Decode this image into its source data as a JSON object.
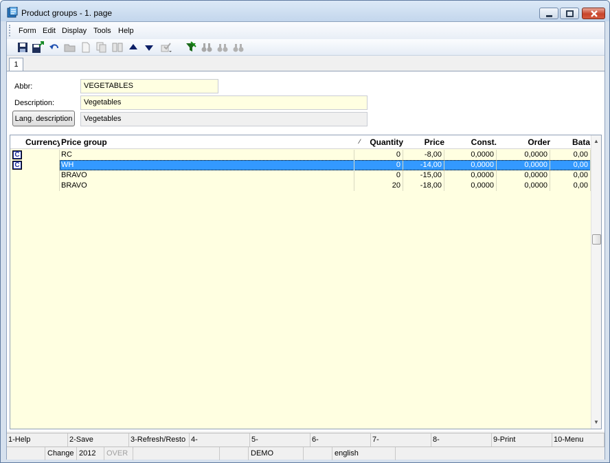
{
  "window": {
    "title": "Product groups - 1. page"
  },
  "menu": [
    "Form",
    "Edit",
    "Display",
    "Tools",
    "Help"
  ],
  "toolbar_icons": [
    "save-icon",
    "save-close-icon",
    "undo-icon",
    "open-folder-icon",
    "new-document-icon",
    "copy-icon",
    "book-icon",
    "arrow-up-icon",
    "arrow-down-icon",
    "check-icon",
    "filter-icon",
    "binoculars-icon",
    "find-next-icon",
    "find-prev-icon"
  ],
  "tab": {
    "label": "1"
  },
  "form": {
    "abbr_label": "Abbr:",
    "abbr_value": "VEGETABLES",
    "description_label": "Description:",
    "description_value": "Vegetables",
    "lang_button": "Lang. description",
    "lang_value": "Vegetables"
  },
  "grid": {
    "columns": [
      "Currency",
      "Price group",
      "Quantity",
      "Price",
      "Const.",
      "Order",
      "Bata"
    ],
    "rows": [
      {
        "currency_icon": "C",
        "price_group": "RC",
        "quantity": "0",
        "price": "-8,00",
        "const": "0,0000",
        "order": "0,0000",
        "bata": "0,00"
      },
      {
        "currency_icon": "C",
        "price_group": "WH",
        "quantity": "0",
        "price": "-14,00",
        "const": "0,0000",
        "order": "0,0000",
        "bata": "0,00"
      },
      {
        "currency_icon": "",
        "price_group": "BRAVO",
        "quantity": "0",
        "price": "-15,00",
        "const": "0,0000",
        "order": "0,0000",
        "bata": "0,00"
      },
      {
        "currency_icon": "",
        "price_group": "BRAVO",
        "quantity": "20",
        "price": "-18,00",
        "const": "0,0000",
        "order": "0,0000",
        "bata": "0,00"
      }
    ],
    "selected_row": 1
  },
  "fkeys": [
    "1-Help",
    "2-Save",
    "3-Refresh/Resto",
    "4-",
    "5-",
    "6-",
    "7-",
    "8-",
    "9-Print",
    "10-Menu"
  ],
  "status": {
    "mode": "Change",
    "year": "2012",
    "over": "OVER",
    "database": "DEMO",
    "language": "english"
  },
  "colors": {
    "selection": "#3399ff",
    "field_bg": "#ffffe1",
    "currency_icon": "#1c2f9c"
  }
}
